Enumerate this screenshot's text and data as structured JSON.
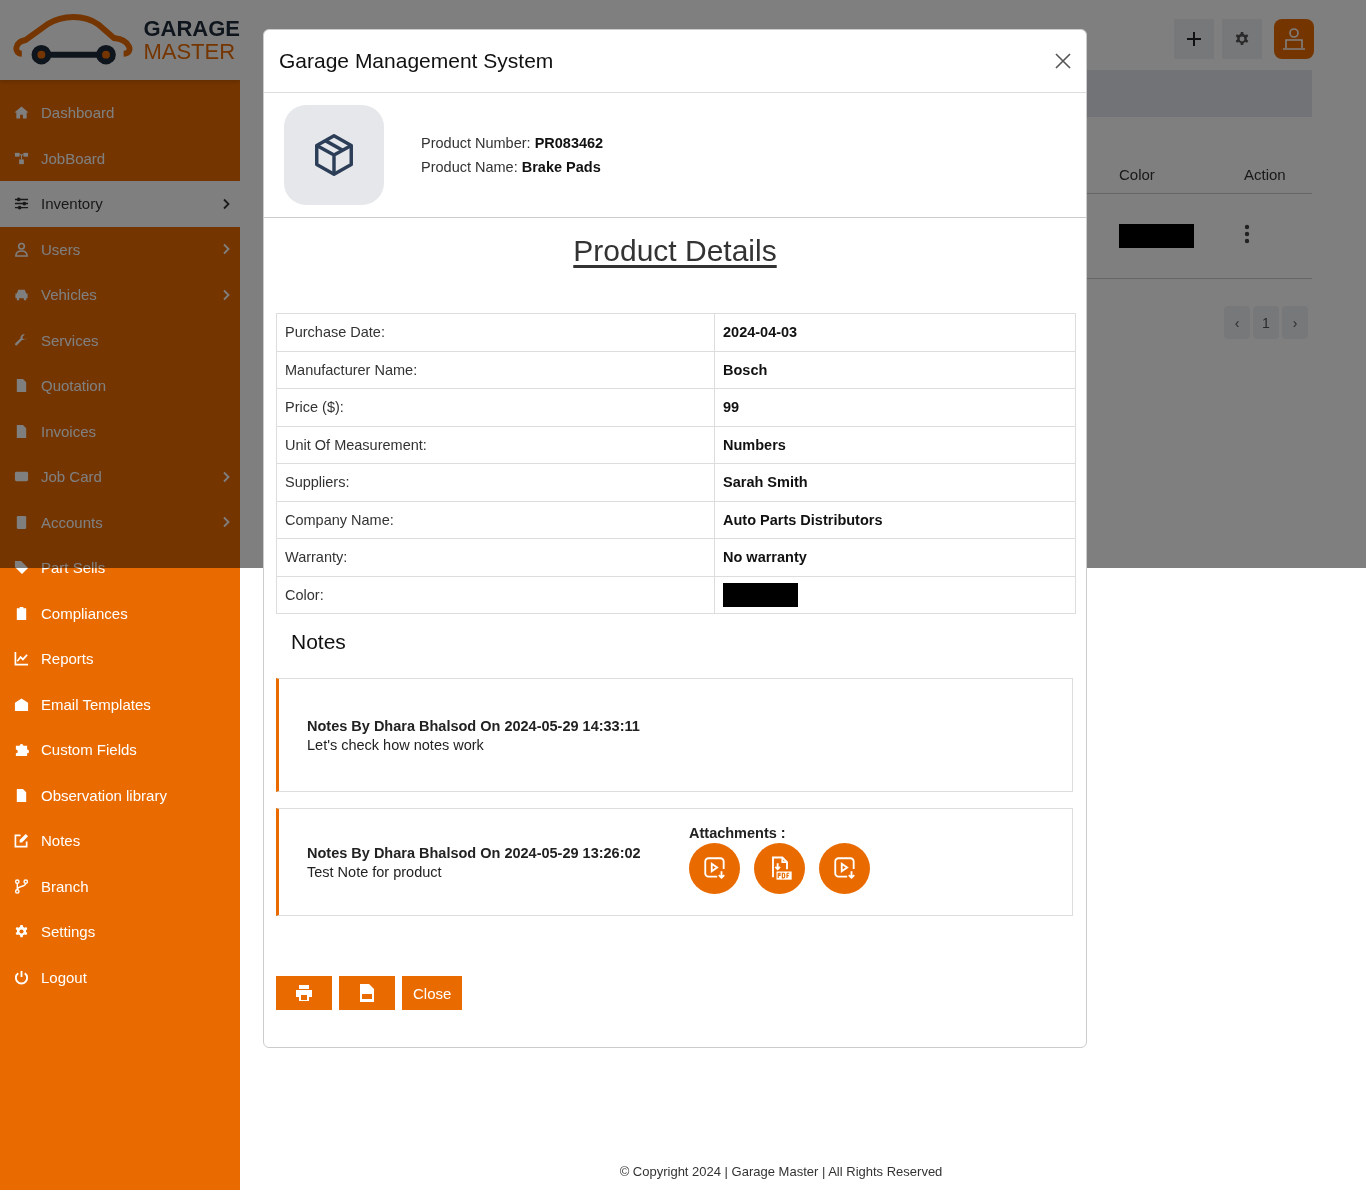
{
  "sidebar": {
    "logo": {
      "line_1": "GARAGE",
      "line_2": "MASTER"
    },
    "items": [
      {
        "label": "Dashboard",
        "selected": false,
        "expandable": false
      },
      {
        "label": "JobBoard",
        "selected": false,
        "expandable": false
      },
      {
        "label": "Inventory",
        "selected": true,
        "expandable": true
      },
      {
        "label": "Users",
        "selected": false,
        "expandable": true
      },
      {
        "label": "Vehicles",
        "selected": false,
        "expandable": true
      },
      {
        "label": "Services",
        "selected": false,
        "expandable": false
      },
      {
        "label": "Quotation",
        "selected": false,
        "expandable": false
      },
      {
        "label": "Invoices",
        "selected": false,
        "expandable": false
      },
      {
        "label": "Job Card",
        "selected": false,
        "expandable": true
      },
      {
        "label": "Accounts",
        "selected": false,
        "expandable": true
      },
      {
        "label": "Part Sells",
        "selected": false,
        "expandable": false
      },
      {
        "label": "Compliances",
        "selected": false,
        "expandable": false
      },
      {
        "label": "Reports",
        "selected": false,
        "expandable": false
      },
      {
        "label": "Email Templates",
        "selected": false,
        "expandable": false
      },
      {
        "label": "Custom Fields",
        "selected": false,
        "expandable": false
      },
      {
        "label": "Observation library",
        "selected": false,
        "expandable": false
      },
      {
        "label": "Notes",
        "selected": false,
        "expandable": false
      },
      {
        "label": "Branch",
        "selected": false,
        "expandable": false
      },
      {
        "label": "Settings",
        "selected": false,
        "expandable": false
      },
      {
        "label": "Logout",
        "selected": false,
        "expandable": false
      }
    ]
  },
  "background_table": {
    "columns": [
      "Color",
      "Action"
    ],
    "rows": [
      {
        "color": "#000000"
      }
    ],
    "pagination": {
      "previous": "‹",
      "pages": [
        "1"
      ],
      "next": "›"
    }
  },
  "modal": {
    "title": "Garage Management System",
    "product_number": "Product Number: **PR083462**",
    "product_name": "Product Name: **Brake Pads**",
    "heading": "Product Details",
    "details": [
      {
        "kind": "text",
        "label": "Purchase Date:",
        "value": "2024-04-03"
      },
      {
        "kind": "text",
        "label": "Manufacturer Name:",
        "value": "Bosch"
      },
      {
        "kind": "text",
        "label": "Price ($):",
        "value": "99"
      },
      {
        "kind": "text",
        "label": "Unit Of Measurement:",
        "value": "Numbers"
      },
      {
        "kind": "text",
        "label": "Suppliers:",
        "value": "Sarah Smith"
      },
      {
        "kind": "text",
        "label": "Company Name:",
        "value": "Auto Parts Distributors"
      },
      {
        "kind": "text",
        "label": "Warranty:",
        "value": "No warranty"
      },
      {
        "kind": "color",
        "label": "Color:",
        "color": "#000000"
      }
    ],
    "notes_heading": "Notes",
    "notes": [
      {
        "header": "Notes By Dhara Bhalsod On 2024-05-29 14:33:11",
        "text": "Let's check how notes work"
      },
      {
        "header": "Notes By Dhara Bhalsod On 2024-05-29 13:26:02",
        "text": "Test Note for product",
        "attachments_label": "Attachments :",
        "attachments": [
          {
            "kind": "video"
          },
          {
            "kind": "pdf"
          },
          {
            "kind": "video"
          }
        ]
      }
    ],
    "buttons": [
      {
        "kind": "print"
      },
      {
        "kind": "pdf"
      },
      {
        "kind": "text",
        "label": "Close"
      }
    ]
  },
  "footer": "© Copyright 2024 | Garage Master | All Rights Reserved"
}
